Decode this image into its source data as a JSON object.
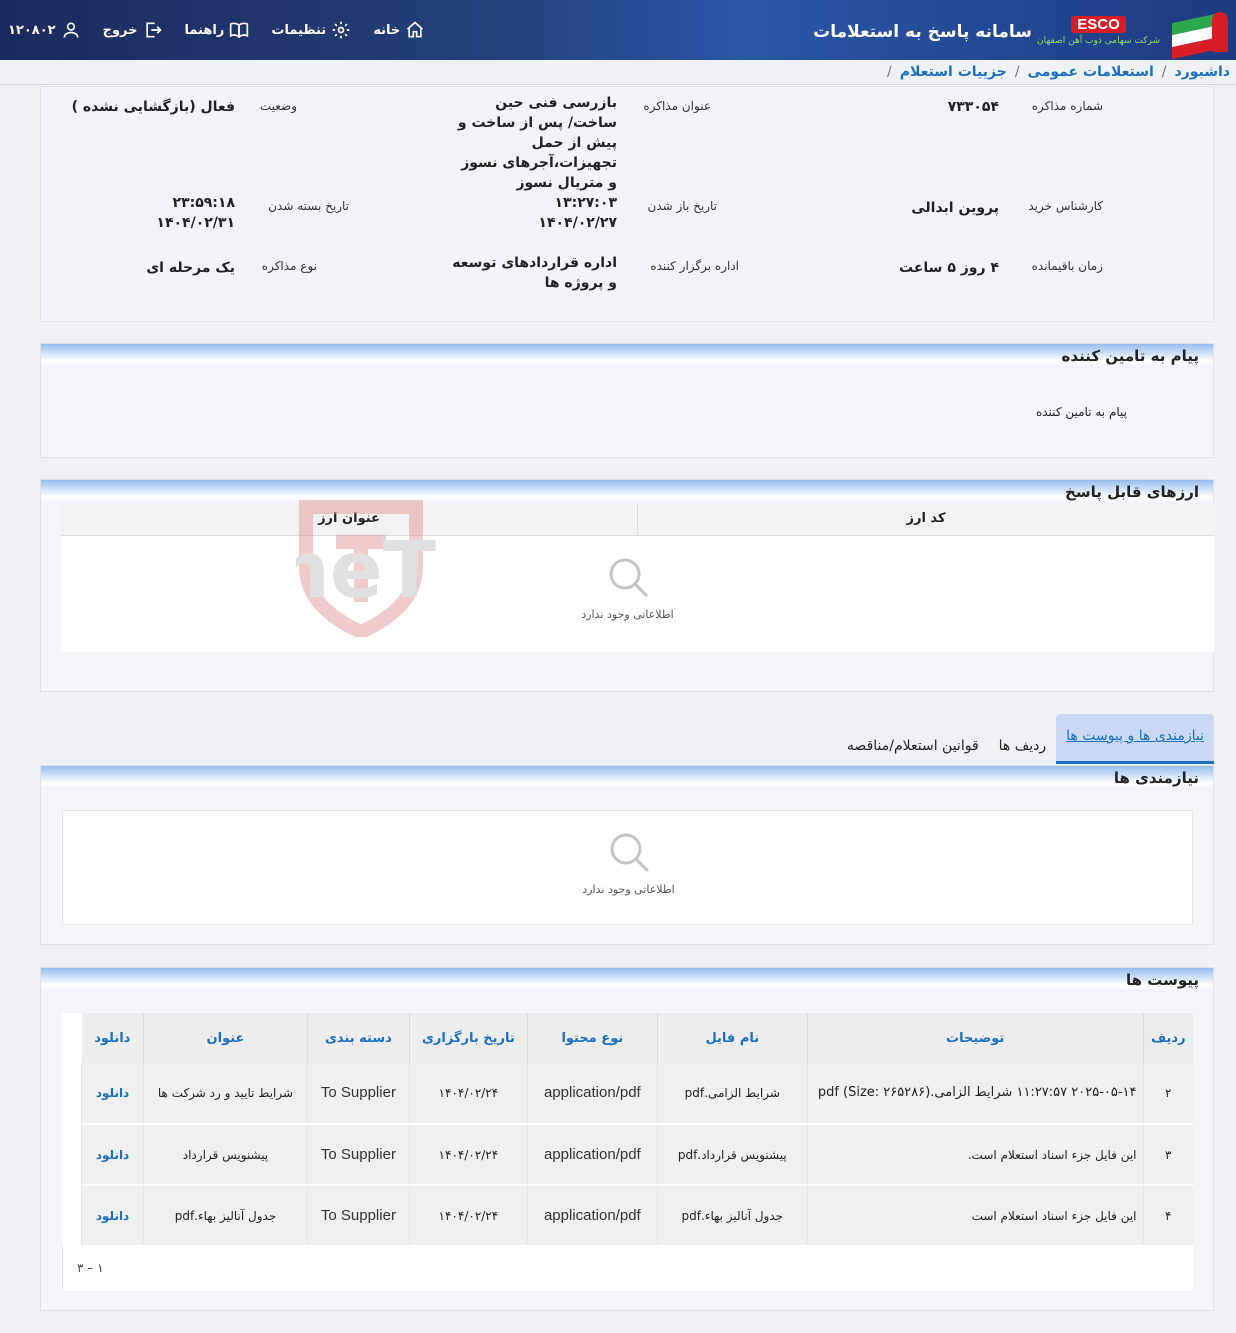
{
  "header": {
    "app_title": "سامانه پاسخ به استعلامات",
    "brand": "ESCO",
    "brand_sub": "شرکت سهامی ذوب آهن اصفهان",
    "nav": {
      "home": "خانه",
      "settings": "تنظیمات",
      "guide": "راهنما",
      "logout": "خروج",
      "user_id": "۱۲۰۸۰۲"
    }
  },
  "breadcrumb": [
    "داشبورد",
    "استعلامات عمومی",
    "جزییات استعلام"
  ],
  "info": {
    "number_label": "شماره مذاکره",
    "number_value": "۷۳۳۰۵۴",
    "title_label": "عنوان مذاکره",
    "title_value": "بازرسی فنی حین ساخت/ پس از ساخت و پیش از حمل تجهیزات،آجرهای نسوز و متریال نسوز",
    "status_label": "وضعیت",
    "status_value": "فعال (بازگشایی نشده )",
    "buyer_label": "کارشناس خرید",
    "buyer_value": "پروین ابدالی",
    "open_label": "تاریخ باز شدن",
    "open_time": "۱۳:۲۷:۰۳",
    "open_date": "۱۴۰۴/۰۲/۲۷",
    "close_label": "تاریخ بسته شدن",
    "close_time": "۲۳:۵۹:۱۸",
    "close_date": "۱۴۰۴/۰۲/۳۱",
    "remaining_label": "زمان باقیمانده",
    "remaining_value": "۴ روز ۵ ساعت",
    "org_label": "اداره برگزار کننده",
    "org_value": "اداره قراردادهای توسعه و پروژه ها",
    "type_label": "نوع مذاکره",
    "type_value": "یک مرحله ای"
  },
  "supplier_message": {
    "title": "پیام به تامین کننده",
    "label": "پیام به تامین کننده"
  },
  "currencies": {
    "title": "ارزهای قابل پاسخ",
    "col_code": "کد ارز",
    "col_title": "عنوان ارز",
    "empty": "اطلاعاتی وجود ندارد"
  },
  "tabs": [
    "نیازمندی ها و پیوست ها",
    "ردیف ها",
    "قوانین استعلام/مناقصه"
  ],
  "needs": {
    "title": "نیازمندی ها",
    "empty": "اطلاعاتی وجود ندارد"
  },
  "attachments": {
    "title": "پیوست ها",
    "columns": [
      "ردیف",
      "توضیحات",
      "نام فایل",
      "نوع محتوا",
      "تاریخ بارگزاری",
      "دسته بندی",
      "عنوان",
      "دانلود"
    ],
    "rows": [
      {
        "row": "۲",
        "desc": "۲۰۲۵-۰۵-۱۴ ۱۱:۲۷:۵۷ شرایط الزامی.pdf (Size: ۲۶۵۲۸۶)",
        "file": "شرایط الزامی.pdf",
        "type": "application/pdf",
        "date": "۱۴۰۴/۰۲/۲۴",
        "category": "To Supplier",
        "title": "شرایط تایید و رد شرکت ها",
        "download": "دانلود"
      },
      {
        "row": "۳",
        "desc": "این فایل جزء اسناد استعلام است.",
        "file": "پیشنویس قرارداد.pdf",
        "type": "application/pdf",
        "date": "۱۴۰۴/۰۲/۲۴",
        "category": "To Supplier",
        "title": "پیشنویس قرارداد",
        "download": "دانلود"
      },
      {
        "row": "۴",
        "desc": "این فایل جزء اسناد استعلام است",
        "file": "جدول آنالیز بهاء.pdf",
        "type": "application/pdf",
        "date": "۱۴۰۴/۰۲/۲۴",
        "category": "To Supplier",
        "title": "جدول آنالیز بهاء.pdf",
        "download": "دانلود"
      }
    ],
    "pager": "۱ – ۳"
  },
  "watermark": "AriaTender.neT",
  "colors": {
    "accent": "#1b6fc4",
    "header": "#24407a",
    "brand_red": "#d71e26"
  }
}
